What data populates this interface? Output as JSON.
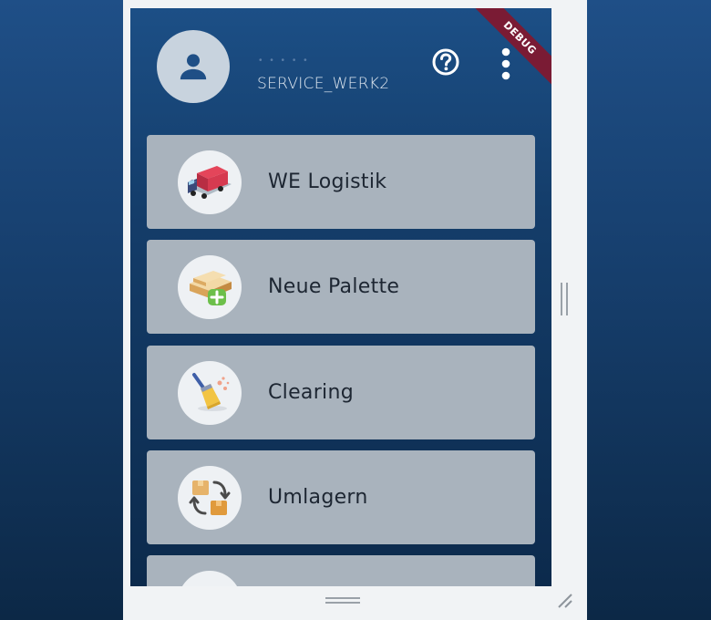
{
  "header": {
    "username_masked": "• • • • •",
    "account": "SERVICE_WERK2",
    "debug_label": "DEBUG"
  },
  "icons": {
    "avatar": "person-icon",
    "help": "help-circle-icon",
    "more": "more-vertical-icon"
  },
  "menu": [
    {
      "label": "WE Logistik",
      "icon": "truck-icon"
    },
    {
      "label": "Neue Palette",
      "icon": "pallet-add-icon"
    },
    {
      "label": "Clearing",
      "icon": "broom-icon"
    },
    {
      "label": "Umlagern",
      "icon": "relocate-boxes-icon"
    }
  ],
  "colors": {
    "accent_bg": "#1c4f86",
    "card_bg": "#a9b3bd",
    "debug_banner": "#7a1b34"
  }
}
